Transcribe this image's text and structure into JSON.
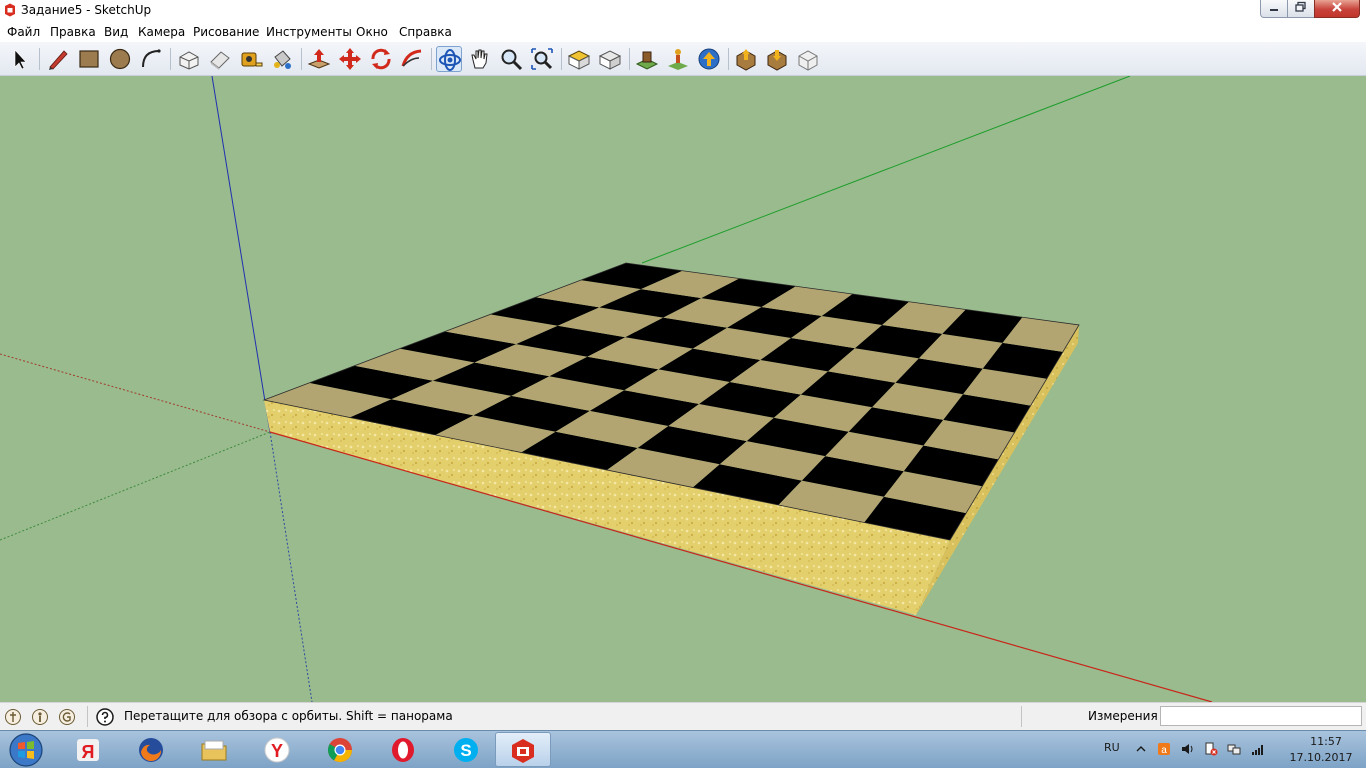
{
  "window": {
    "title": "Задание5 - SketchUp"
  },
  "menu": [
    "Файл",
    "Правка",
    "Вид",
    "Камера",
    "Рисование",
    "Инструменты",
    "Окно",
    "Справка"
  ],
  "toolbar_icons": [
    "select-icon",
    "pencil-icon",
    "rectangle-icon",
    "circle-icon",
    "arc-icon",
    "make-component-icon",
    "eraser-icon",
    "tape-measure-icon",
    "paint-bucket-icon",
    "push-pull-icon",
    "move-icon",
    "rotate-icon",
    "follow-me-icon",
    "orbit-icon",
    "pan-icon",
    "zoom-icon",
    "zoom-extents-icon",
    "top-view-icon",
    "previous-view-icon",
    "add-location-icon",
    "toggle-terrain-icon",
    "share-model-icon",
    "get-models-icon",
    "share-component-icon",
    "extension-warehouse-icon"
  ],
  "active_tool": "orbit-icon",
  "status": {
    "hint": "Перетащите для обзора с орбиты.  Shift = панорама",
    "measurements_label": "Измерения",
    "measurements_value": ""
  },
  "taskbar": {
    "apps": [
      "yandex-browser-icon",
      "firefox-icon",
      "file-explorer-icon",
      "yandex-icon",
      "chrome-icon",
      "opera-icon",
      "skype-icon",
      "sketchup-icon"
    ],
    "active_app": "sketchup-icon",
    "language": "RU",
    "time": "11:57",
    "date": "17.10.2017"
  },
  "scene": {
    "object": "chessboard",
    "rows": 8,
    "cols": 8,
    "dark_color": "#000000",
    "light_color": "#b3a572",
    "side_color": "#e4cf6d",
    "background_color": "#99bb8d",
    "axis_red": "#c8261a",
    "axis_green": "#1d9d2b",
    "axis_blue": "#2030b0"
  }
}
